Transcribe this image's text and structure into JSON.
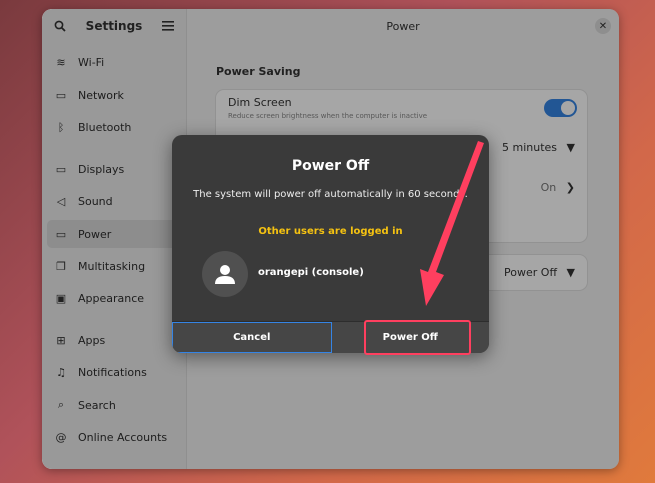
{
  "sidebar": {
    "title": "Settings",
    "items": [
      {
        "label": "Wi-Fi",
        "icon": "wifi-icon",
        "glyph": "≋"
      },
      {
        "label": "Network",
        "icon": "network-icon",
        "glyph": "▭"
      },
      {
        "label": "Bluetooth",
        "icon": "bluetooth-icon",
        "glyph": "ᛒ"
      },
      {
        "label": "Displays",
        "icon": "display-icon",
        "glyph": "▭"
      },
      {
        "label": "Sound",
        "icon": "speaker-icon",
        "glyph": "◁"
      },
      {
        "label": "Power",
        "icon": "power-icon",
        "glyph": "▭"
      },
      {
        "label": "Multitasking",
        "icon": "multitasking-icon",
        "glyph": "❐"
      },
      {
        "label": "Appearance",
        "icon": "appearance-icon",
        "glyph": "▣"
      },
      {
        "label": "Apps",
        "icon": "apps-icon",
        "glyph": "⊞"
      },
      {
        "label": "Notifications",
        "icon": "bell-icon",
        "glyph": "♫"
      },
      {
        "label": "Search",
        "icon": "search-icon",
        "glyph": "⌕"
      },
      {
        "label": "Online Accounts",
        "icon": "at-icon",
        "glyph": "@"
      }
    ]
  },
  "main": {
    "title": "Power",
    "section_title": "Power Saving",
    "dim_screen": {
      "label": "Dim Screen",
      "description": "Reduce screen brightness when the computer is inactive",
      "enabled": true
    },
    "blank_value": "5 minutes",
    "auto_suspend_value": "On",
    "power_button_value": "Power Off"
  },
  "dialog": {
    "title": "Power Off",
    "message": "The system will power off automatically in 60 seconds.",
    "warning": "Other users are logged in",
    "user": "orangepi (console)",
    "cancel_label": "Cancel",
    "confirm_label": "Power Off"
  },
  "colors": {
    "accent": "#3584e4",
    "warning": "#f5c211",
    "annotation": "#ff3f5f"
  }
}
